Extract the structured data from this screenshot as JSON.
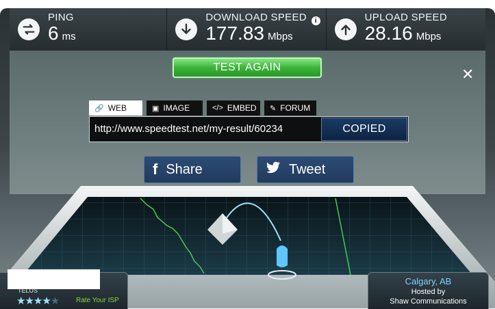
{
  "stats": {
    "ping": {
      "label": "PING",
      "value": "6",
      "unit": "ms"
    },
    "download": {
      "label": "DOWNLOAD SPEED",
      "value": "177.83",
      "unit": "Mbps"
    },
    "upload": {
      "label": "UPLOAD SPEED",
      "value": "28.16",
      "unit": "Mbps"
    }
  },
  "actions": {
    "test_again": "TEST AGAIN",
    "close": "✕"
  },
  "share_tabs": [
    {
      "label": "WEB",
      "icon": "link-icon"
    },
    {
      "label": "IMAGE",
      "icon": "image-icon"
    },
    {
      "label": "EMBED",
      "icon": "code-icon"
    },
    {
      "label": "FORUM",
      "icon": "forum-icon"
    }
  ],
  "result": {
    "url": "http://www.speedtest.net/my-result/60234",
    "copy_state": "COPIED"
  },
  "social": {
    "facebook": "Share",
    "twitter": "Tweet"
  },
  "isp": {
    "name": "TELUS",
    "rating": 4,
    "max_rating": 5,
    "rate_label": "Rate Your ISP"
  },
  "server": {
    "city": "Calgary, AB",
    "hosted_by": "Hosted by",
    "host": "Shaw Communications"
  },
  "colors": {
    "accent_green": "#3db23b",
    "link_blue": "#7fd4ff",
    "rate_green": "#8cd43d"
  }
}
